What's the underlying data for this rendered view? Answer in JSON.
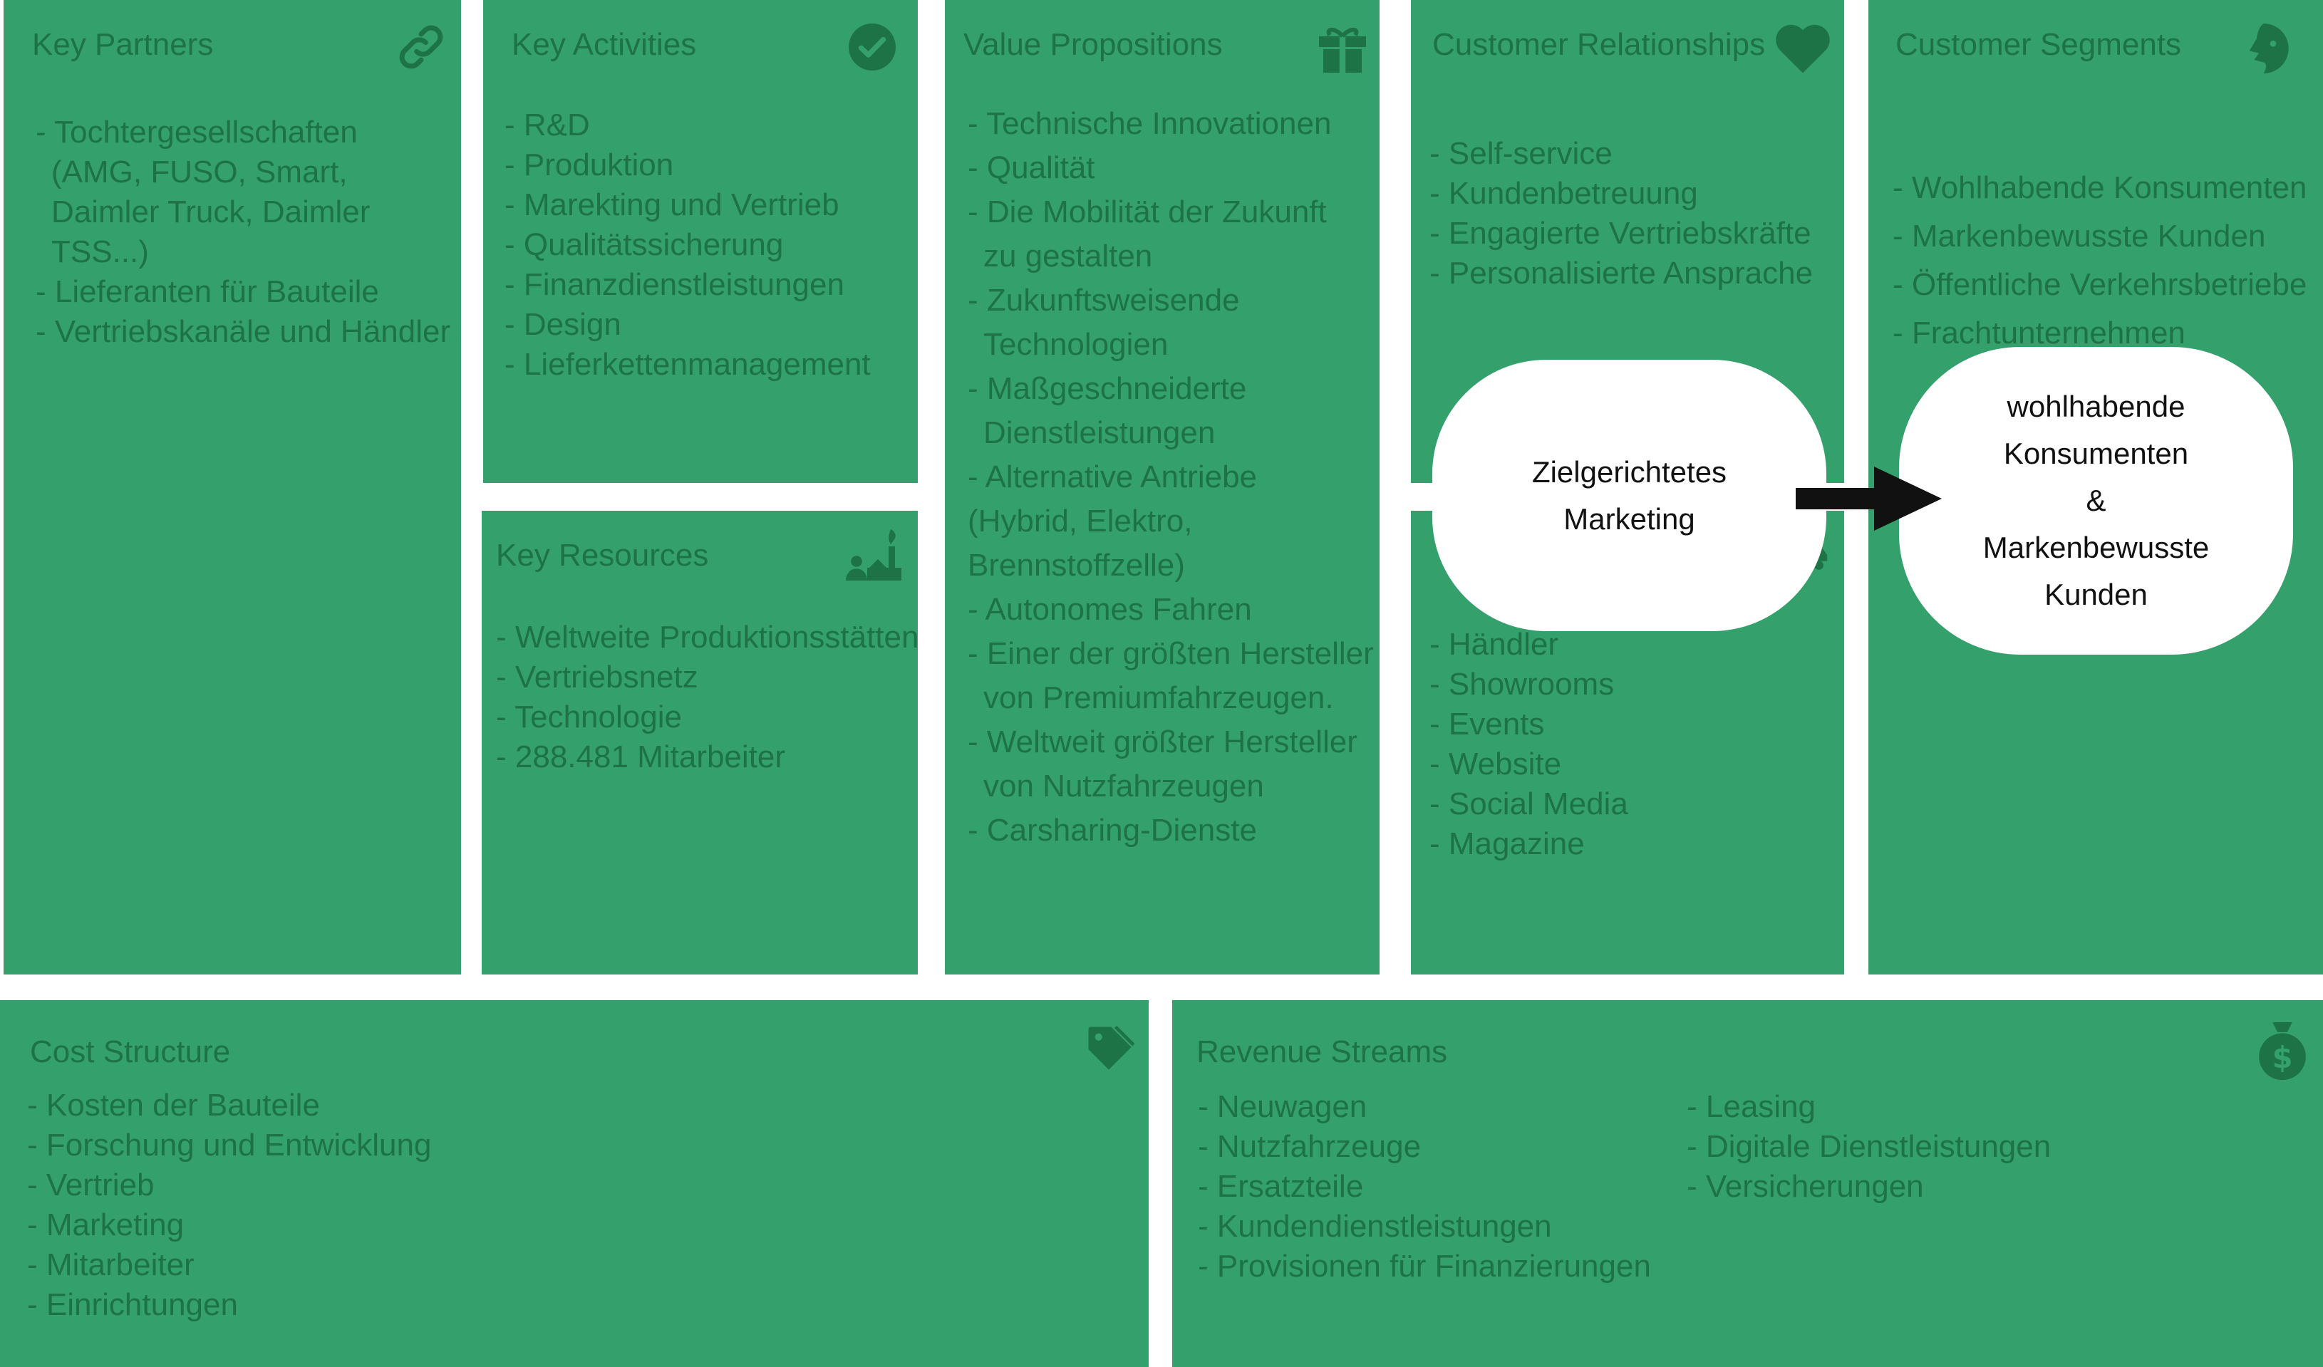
{
  "colors": {
    "panel": "#34a16c",
    "text": "#1d7346",
    "bubble": "#ffffff",
    "arrow": "#111111"
  },
  "key_partners": {
    "title": "Key Partners",
    "icon": "link-icon",
    "items": [
      "Tochtergesellschaften (AMG, FUSO, Smart, Daimler Truck, Daimler TSS...)",
      "Lieferanten für Bauteile",
      "Vertriebskanäle und Händler"
    ]
  },
  "key_activities": {
    "title": "Key Activities",
    "icon": "check-circle-icon",
    "items": [
      "R&D",
      "Produktion",
      "Marekting und Vertrieb",
      "Qualitätssicherung",
      "Finanzdienstleistungen",
      "Design",
      "Lieferkettenmanagement"
    ]
  },
  "key_resources": {
    "title": "Key Resources",
    "icon": "factory-worker-icon",
    "items": [
      "Weltweite Produktionsstätten",
      "Vertriebsnetz",
      "Technologie",
      "288.481 Mitarbeiter"
    ]
  },
  "value_propositions": {
    "title": "Value Propositions",
    "icon": "gift-icon",
    "items": [
      "Technische Innovationen",
      "Qualität",
      "Die Mobilität der Zukunft zu gestalten",
      "Zukunftsweisende Technologien",
      "Maßgeschneiderte Dienstleistungen",
      "Alternative Antriebe (Hybrid, Elektro, Brennstoffzelle)",
      "Autonomes Fahren",
      "Einer der größten Hersteller von Premiumfahrzeugen.",
      "Weltweit größter Hersteller von Nutzfahrzeugen",
      "Carsharing-Dienste"
    ]
  },
  "customer_relationships": {
    "title": "Customer Relationships",
    "icon": "heart-icon",
    "items": [
      "Self-service",
      "Kundenbetreuung",
      "Engagierte Vertriebskräfte",
      "Personalisierte Ansprache"
    ]
  },
  "channels": {
    "icon": "truck-icon",
    "items": [
      "Händler",
      "Showrooms",
      "Events",
      "Website",
      "Social Media",
      "Magazine"
    ]
  },
  "customer_segments": {
    "title": "Customer Segments",
    "icon": "face-icon",
    "items": [
      "Wohlhabende Konsumenten",
      "Markenbewusste Kunden",
      "Öffentliche Verkehrsbetriebe",
      "Frachtunternehmen"
    ]
  },
  "cost_structure": {
    "title": "Cost Structure",
    "icon": "tag-icon",
    "items": [
      "Kosten der Bauteile",
      "Forschung und Entwicklung",
      "Vertrieb",
      "Marketing",
      "Mitarbeiter",
      "Einrichtungen"
    ]
  },
  "revenue_streams": {
    "title": "Revenue Streams",
    "icon": "money-bag-icon",
    "items_left": [
      "Neuwagen",
      "Nutzfahrzeuge",
      "Ersatzteile",
      "Kundendienstleistungen",
      "Provisionen für Finanzierungen"
    ],
    "items_right": [
      "Leasing",
      "Digitale Dienstleistungen",
      "Versicherungen"
    ]
  },
  "callouts": {
    "marketing": "Zielgerichtetes\nMarketing",
    "target": "wohlhabende\nKonsumenten\n&\nMarkenbewusste\nKunden"
  }
}
